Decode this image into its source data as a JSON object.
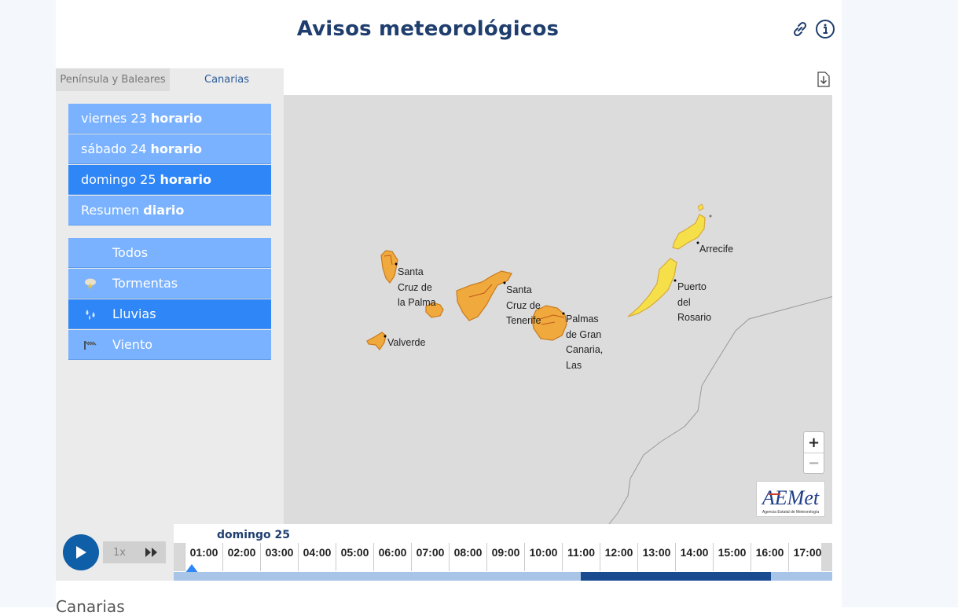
{
  "page": {
    "title": "Avisos meteorológicos"
  },
  "header_icons": [
    "link-icon",
    "info-icon"
  ],
  "tabs": [
    {
      "label": "Península y Baleares",
      "active": false
    },
    {
      "label": "Canarias",
      "active": true
    }
  ],
  "days": [
    {
      "day": "viernes 23",
      "mode": "horario",
      "active": false
    },
    {
      "day": "sábado 24",
      "mode": "horario",
      "active": false
    },
    {
      "day": "domingo 25",
      "mode": "horario",
      "active": true
    },
    {
      "day": "Resumen",
      "mode": "diario",
      "active": false
    }
  ],
  "filters": [
    {
      "label": "Todos",
      "icon": "",
      "active": false
    },
    {
      "label": "Tormentas",
      "icon": "storm-icon",
      "active": false
    },
    {
      "label": "Lluvias",
      "icon": "rain-icon",
      "active": true
    },
    {
      "label": "Viento",
      "icon": "wind-icon",
      "active": false
    }
  ],
  "map": {
    "cities": {
      "santa_cruz_palma": [
        "Santa",
        "Cruz de",
        "la Palma"
      ],
      "valverde": [
        "Valverde"
      ],
      "santa_cruz_tenerife": [
        "Santa",
        "Cruz de",
        "Tenerife"
      ],
      "las_palmas": [
        "Palmas",
        "de Gran",
        "Canaria,",
        "Las"
      ],
      "arrecife": [
        "Arrecife"
      ],
      "puerto_rosario": [
        "Puerto",
        "del",
        "Rosario"
      ]
    },
    "warning_colors": {
      "orange": "#f0a93c",
      "yellow": "#f5e04a"
    },
    "zoom_in": "+",
    "zoom_out": "−",
    "logo": {
      "name": "AEMet",
      "subtitle": "Agencia Estatal de Meteorología"
    }
  },
  "timeline": {
    "date": "domingo 25",
    "hours": [
      "01:00",
      "02:00",
      "03:00",
      "04:00",
      "05:00",
      "06:00",
      "07:00",
      "08:00",
      "09:00",
      "10:00",
      "11:00",
      "12:00",
      "13:00",
      "14:00",
      "15:00",
      "16:00",
      "17:00"
    ],
    "speed": "1x",
    "selected_hour": "01:00"
  },
  "section_title": "Canarias"
}
